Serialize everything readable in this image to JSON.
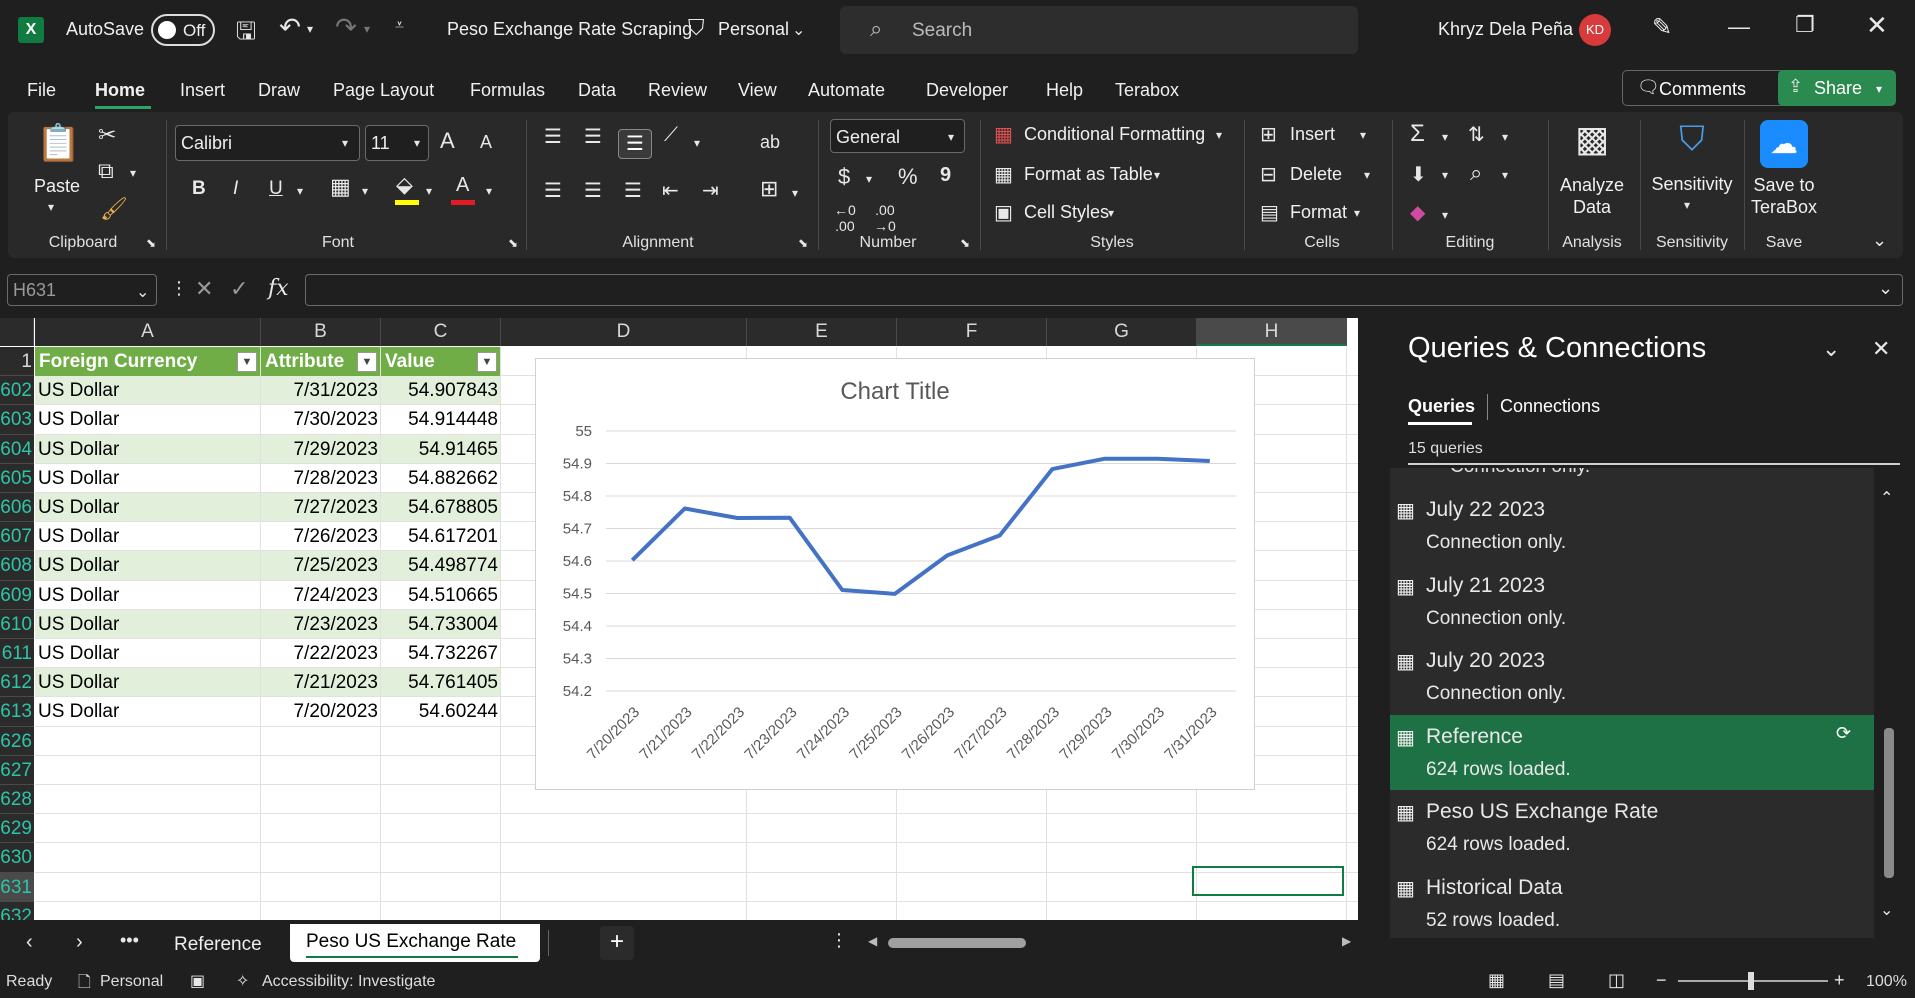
{
  "title_bar": {
    "autosave_label": "AutoSave",
    "autosave_state": "Off",
    "doc_title": "Peso Exchange Rate Scraping",
    "sensitivity": "Personal",
    "search_placeholder": "Search",
    "user_name": "Khryz Dela Peña",
    "user_initials": "KD"
  },
  "ribbon_tabs": [
    "File",
    "Home",
    "Insert",
    "Draw",
    "Page Layout",
    "Formulas",
    "Data",
    "Review",
    "View",
    "Automate",
    "Developer",
    "Help",
    "Terabox"
  ],
  "active_tab": "Home",
  "header_buttons": {
    "comments": "Comments",
    "share": "Share"
  },
  "ribbon": {
    "clipboard": {
      "paste": "Paste",
      "label": "Clipboard"
    },
    "font": {
      "name": "Calibri",
      "size": "11",
      "label": "Font",
      "bold": "B",
      "italic": "I",
      "underline": "U",
      "grow": "A",
      "shrink": "A",
      "font_color": "A"
    },
    "alignment": {
      "label": "Alignment"
    },
    "number": {
      "format": "General",
      "label": "Number",
      "currency": "$",
      "percent": "%",
      "comma": "9"
    },
    "styles": {
      "conditional": "Conditional Formatting",
      "table": "Format as Table",
      "cell_styles": "Cell Styles",
      "label": "Styles"
    },
    "cells": {
      "insert": "Insert",
      "delete": "Delete",
      "format": "Format",
      "label": "Cells"
    },
    "editing": {
      "label": "Editing"
    },
    "analysis": {
      "button": "Analyze Data",
      "label": "Analysis"
    },
    "sensitivity": {
      "button": "Sensitivity",
      "label": "Sensitivity"
    },
    "save": {
      "button": "Save to TeraBox",
      "label": "Save"
    }
  },
  "formula_bar": {
    "name_box": "H631",
    "formula": "",
    "fx": "fx"
  },
  "columns": [
    "A",
    "B",
    "C",
    "D",
    "E",
    "F",
    "G",
    "H"
  ],
  "table_headers": [
    "Foreign Currency",
    "Attribute",
    "Value"
  ],
  "rows": [
    {
      "num": "1",
      "cells": [
        "",
        "",
        ""
      ]
    },
    {
      "num": "602",
      "cells": [
        "US Dollar",
        "7/31/2023",
        "54.907843"
      ]
    },
    {
      "num": "603",
      "cells": [
        "US Dollar",
        "7/30/2023",
        "54.914448"
      ]
    },
    {
      "num": "604",
      "cells": [
        "US Dollar",
        "7/29/2023",
        "54.91465"
      ]
    },
    {
      "num": "605",
      "cells": [
        "US Dollar",
        "7/28/2023",
        "54.882662"
      ]
    },
    {
      "num": "606",
      "cells": [
        "US Dollar",
        "7/27/2023",
        "54.678805"
      ]
    },
    {
      "num": "607",
      "cells": [
        "US Dollar",
        "7/26/2023",
        "54.617201"
      ]
    },
    {
      "num": "608",
      "cells": [
        "US Dollar",
        "7/25/2023",
        "54.498774"
      ]
    },
    {
      "num": "609",
      "cells": [
        "US Dollar",
        "7/24/2023",
        "54.510665"
      ]
    },
    {
      "num": "610",
      "cells": [
        "US Dollar",
        "7/23/2023",
        "54.733004"
      ]
    },
    {
      "num": "611",
      "cells": [
        "US Dollar",
        "7/22/2023",
        "54.732267"
      ]
    },
    {
      "num": "612",
      "cells": [
        "US Dollar",
        "7/21/2023",
        "54.761405"
      ]
    },
    {
      "num": "613",
      "cells": [
        "US Dollar",
        "7/20/2023",
        "54.60244"
      ]
    },
    {
      "num": "626",
      "cells": [
        "",
        "",
        ""
      ]
    },
    {
      "num": "627",
      "cells": [
        "",
        "",
        ""
      ]
    },
    {
      "num": "628",
      "cells": [
        "",
        "",
        ""
      ]
    },
    {
      "num": "629",
      "cells": [
        "",
        "",
        ""
      ]
    },
    {
      "num": "630",
      "cells": [
        "",
        "",
        ""
      ]
    },
    {
      "num": "631",
      "cells": [
        "",
        "",
        ""
      ]
    },
    {
      "num": "632",
      "cells": [
        "",
        "",
        ""
      ]
    }
  ],
  "chart_data": {
    "type": "line",
    "title": "Chart Title",
    "categories": [
      "7/20/2023",
      "7/21/2023",
      "7/22/2023",
      "7/23/2023",
      "7/24/2023",
      "7/25/2023",
      "7/26/2023",
      "7/27/2023",
      "7/28/2023",
      "7/29/2023",
      "7/30/2023",
      "7/31/2023"
    ],
    "series": [
      {
        "values": [
          54.60244,
          54.761405,
          54.732267,
          54.733004,
          54.510665,
          54.498774,
          54.617201,
          54.678805,
          54.882662,
          54.91465,
          54.914448,
          54.907843
        ],
        "color": "#4472c4"
      }
    ],
    "ylim": [
      54.2,
      55
    ],
    "yticks": [
      "54.2",
      "54.3",
      "54.4",
      "54.5",
      "54.6",
      "54.7",
      "54.8",
      "54.9",
      "55"
    ],
    "grid": true,
    "legend": "none"
  },
  "queries_panel": {
    "title": "Queries & Connections",
    "tabs": [
      "Queries",
      "Connections"
    ],
    "count": "15 queries",
    "partial_top": "Connection only.",
    "items": [
      {
        "name": "July 22 2023",
        "status": "Connection only."
      },
      {
        "name": "July 21 2023",
        "status": "Connection only."
      },
      {
        "name": "July 20 2023",
        "status": "Connection only."
      },
      {
        "name": "Reference",
        "status": "624 rows loaded."
      },
      {
        "name": "Peso US Exchange Rate",
        "status": "624 rows loaded."
      },
      {
        "name": "Historical Data",
        "status": "52 rows loaded."
      }
    ],
    "selected_index": 3
  },
  "sheet_tabs": {
    "items": [
      "Reference",
      "Peso US Exchange Rate"
    ],
    "active": "Peso US Exchange Rate"
  },
  "status_bar": {
    "ready": "Ready",
    "sensitivity": "Personal",
    "accessibility": "Accessibility: Investigate",
    "zoom": "100%"
  },
  "colors": {
    "accent_green": "#107c41",
    "table_header": "#70ad47",
    "band": "#e2efda",
    "chart_line": "#4472c4",
    "selected_query": "#1e7145"
  }
}
